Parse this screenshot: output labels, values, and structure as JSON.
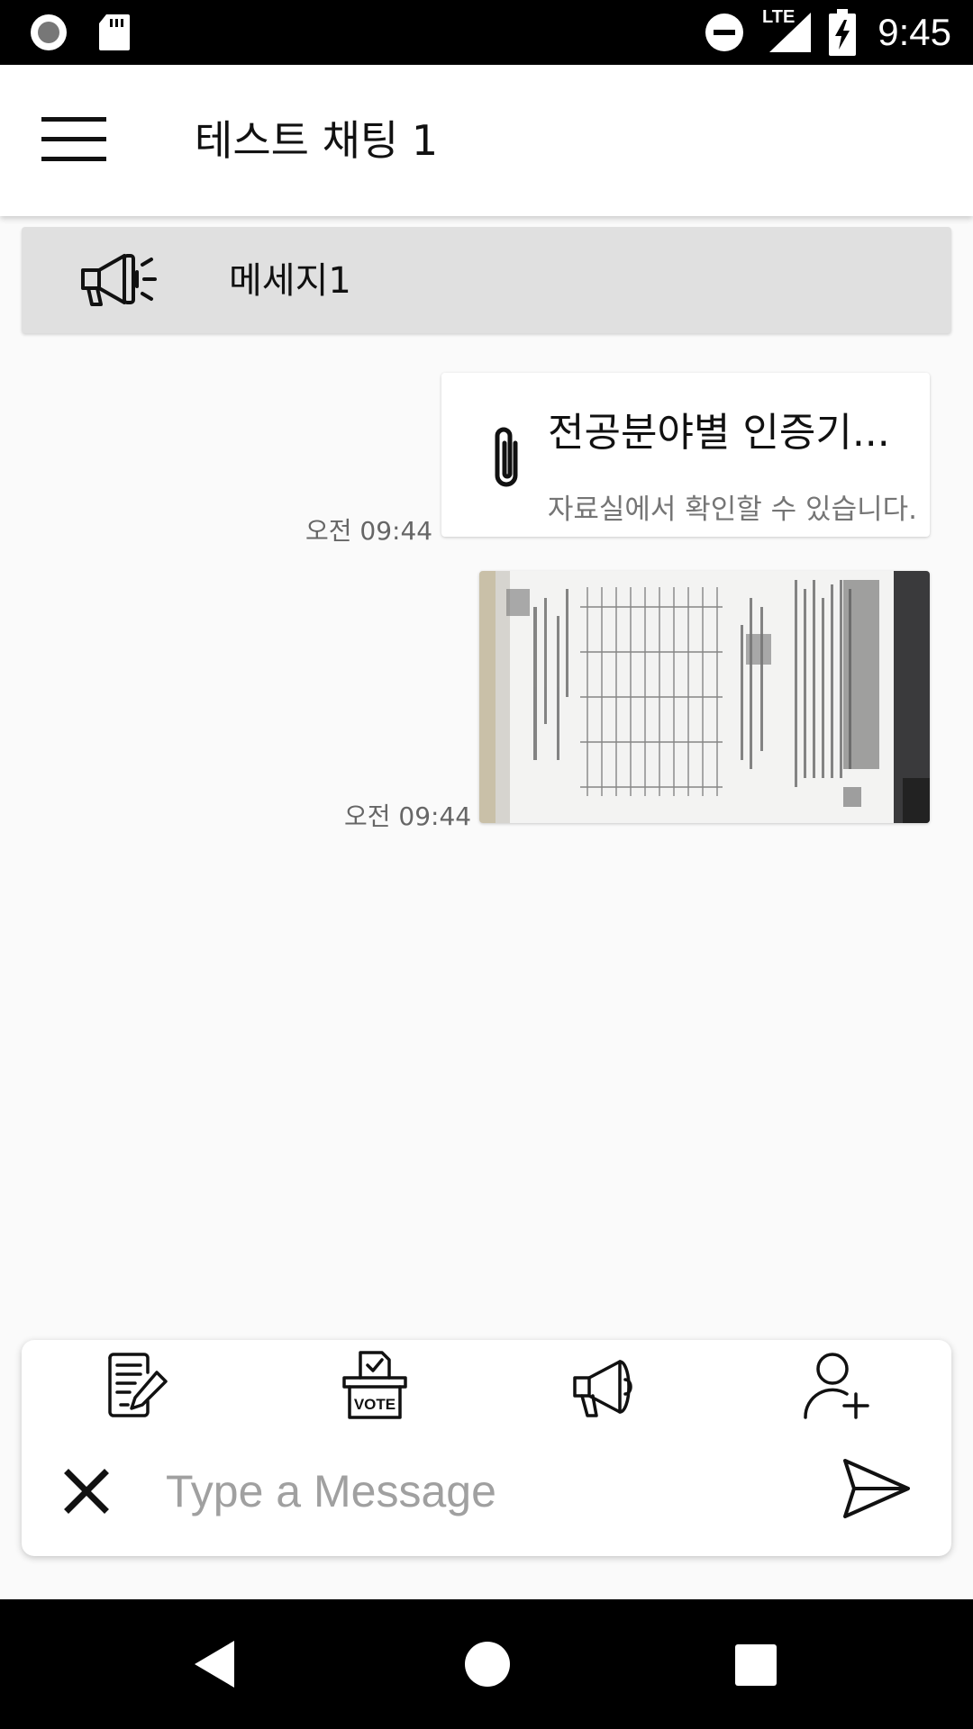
{
  "status_bar": {
    "time": "9:45",
    "network": "LTE",
    "icons": [
      "record-icon",
      "sd-card-icon",
      "do-not-disturb-icon",
      "signal-icon",
      "battery-charging-icon"
    ]
  },
  "header": {
    "title": "테스트 채팅 1",
    "menu_icon": "hamburger-menu-icon"
  },
  "notice": {
    "icon": "megaphone-icon",
    "text": "메세지1"
  },
  "messages": [
    {
      "type": "file",
      "icon": "paperclip-icon",
      "title": "전공분야별 인증기...",
      "subtitle": "자료실에서 확인할 수 있습니다.",
      "time": "오전 09:44"
    },
    {
      "type": "image",
      "description": "photo-of-document",
      "time": "오전 09:44"
    }
  ],
  "compose": {
    "actions": [
      "document-edit-icon",
      "vote-icon",
      "announcement-icon",
      "add-user-icon"
    ],
    "placeholder": "Type a Message",
    "close_icon": "close-icon",
    "send_icon": "send-icon"
  },
  "nav_bar": {
    "icons": [
      "back-icon",
      "home-icon",
      "recents-icon"
    ]
  },
  "colors": {
    "background": "#fafafa",
    "notice_background": "#e0e0e0",
    "bars": "#000000"
  }
}
